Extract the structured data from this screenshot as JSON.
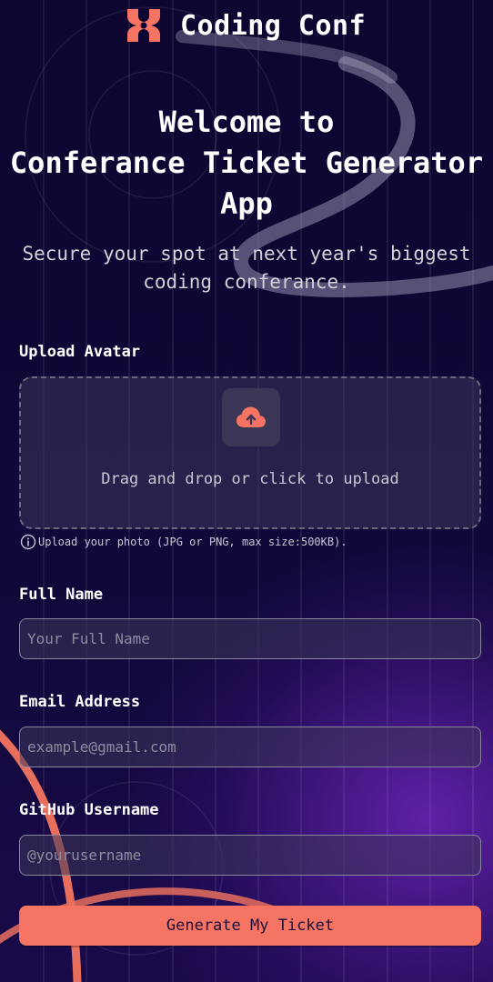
{
  "brand": {
    "name": "Coding Conf",
    "icon": "coding-conf-logo-icon",
    "accent_color": "#f57463"
  },
  "hero": {
    "title_line1": "Welcome to",
    "title_line2": "Conferance Ticket Generator",
    "title_line3": "App",
    "subtitle": "Secure your spot at next year's biggest coding conferance."
  },
  "avatar": {
    "label": "Upload Avatar",
    "dropzone_text": "Drag and drop or click to upload",
    "dropzone_icon": "cloud-upload-icon",
    "hint_icon": "info-icon",
    "hint": "Upload your photo (JPG or PNG, max size:500KB)."
  },
  "full_name": {
    "label": "Full Name",
    "placeholder": "Your Full Name",
    "value": ""
  },
  "email": {
    "label": "Email Address",
    "placeholder": "example@gmail.com",
    "value": ""
  },
  "github": {
    "label": "GitHub Username",
    "placeholder": "@yourusername",
    "value": ""
  },
  "submit": {
    "label": "Generate My Ticket"
  },
  "colors": {
    "background": "#0d0733",
    "accent": "#f57463",
    "field_border": "#8a869c"
  }
}
